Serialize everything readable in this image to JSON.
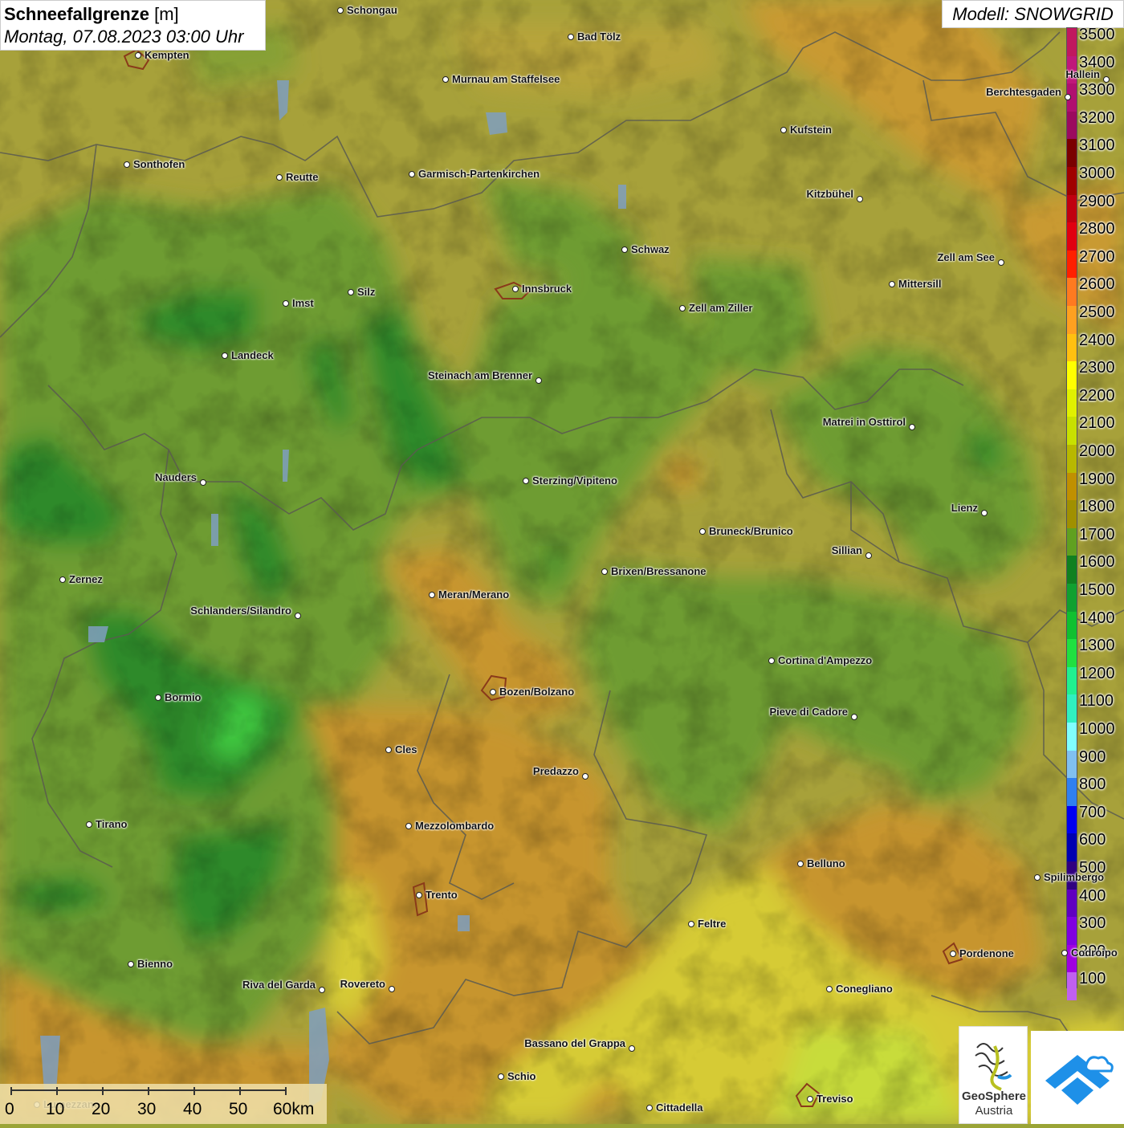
{
  "title": {
    "name": "Schneefallgrenze",
    "unit": "[m]",
    "datetime": "Montag, 07.08.2023 03:00 Uhr"
  },
  "model": "Modell: SNOWGRID",
  "legend": {
    "levels": [
      {
        "label": "3500",
        "color": "#c0185f"
      },
      {
        "label": "3400",
        "color": "#c0187a"
      },
      {
        "label": "3300",
        "color": "#b0106f"
      },
      {
        "label": "3200",
        "color": "#9b0a5f"
      },
      {
        "label": "3100",
        "color": "#7a0000"
      },
      {
        "label": "3000",
        "color": "#a00000"
      },
      {
        "label": "2900",
        "color": "#c00010"
      },
      {
        "label": "2800",
        "color": "#e00010"
      },
      {
        "label": "2700",
        "color": "#ff2000"
      },
      {
        "label": "2600",
        "color": "#ff7a20"
      },
      {
        "label": "2500",
        "color": "#ffa020"
      },
      {
        "label": "2400",
        "color": "#ffc010"
      },
      {
        "label": "2300",
        "color": "#ffff00"
      },
      {
        "label": "2200",
        "color": "#e0f000"
      },
      {
        "label": "2100",
        "color": "#c8e000"
      },
      {
        "label": "2000",
        "color": "#b8b800"
      },
      {
        "label": "1900",
        "color": "#c09000"
      },
      {
        "label": "1800",
        "color": "#a09000"
      },
      {
        "label": "1700",
        "color": "#60a020"
      },
      {
        "label": "1600",
        "color": "#108020"
      },
      {
        "label": "1500",
        "color": "#10a030"
      },
      {
        "label": "1400",
        "color": "#10c030"
      },
      {
        "label": "1300",
        "color": "#20e040"
      },
      {
        "label": "1200",
        "color": "#20f090"
      },
      {
        "label": "1100",
        "color": "#30f0c0"
      },
      {
        "label": "1000",
        "color": "#80ffff"
      },
      {
        "label": "900",
        "color": "#80c0f0"
      },
      {
        "label": "800",
        "color": "#3080f0"
      },
      {
        "label": "700",
        "color": "#0000f0"
      },
      {
        "label": "600",
        "color": "#0000b0"
      },
      {
        "label": "500",
        "color": "#300080"
      },
      {
        "label": "400",
        "color": "#6000c0"
      },
      {
        "label": "300",
        "color": "#8000e0"
      },
      {
        "label": "200",
        "color": "#a000e0"
      },
      {
        "label": "100",
        "color": "#c060f0"
      }
    ]
  },
  "cities": [
    {
      "name": "Schongau",
      "label_side": "right"
    },
    {
      "name": "Bad Tölz",
      "label_side": "right"
    },
    {
      "name": "Kempten",
      "label_side": "right"
    },
    {
      "name": "Murnau am Staffelsee",
      "label_side": "right"
    },
    {
      "name": "Hallein",
      "label_side": "left"
    },
    {
      "name": "Berchtesgaden",
      "label_side": "left"
    },
    {
      "name": "Kufstein",
      "label_side": "right"
    },
    {
      "name": "Sonthofen",
      "label_side": "right"
    },
    {
      "name": "Reutte",
      "label_side": "right"
    },
    {
      "name": "Garmisch-Partenkirchen",
      "label_side": "right"
    },
    {
      "name": "Kitzbühel",
      "label_side": "left"
    },
    {
      "name": "Schwaz",
      "label_side": "right"
    },
    {
      "name": "Zell am See",
      "label_side": "left"
    },
    {
      "name": "Innsbruck",
      "label_side": "right"
    },
    {
      "name": "Mittersill",
      "label_side": "right"
    },
    {
      "name": "Imst",
      "label_side": "right"
    },
    {
      "name": "Silz",
      "label_side": "right"
    },
    {
      "name": "Zell am Ziller",
      "label_side": "right"
    },
    {
      "name": "Landeck",
      "label_side": "right"
    },
    {
      "name": "Steinach am Brenner",
      "label_side": "left"
    },
    {
      "name": "Matrei in Osttirol",
      "label_side": "left"
    },
    {
      "name": "Nauders",
      "label_side": "left"
    },
    {
      "name": "Sterzing/Vipiteno",
      "label_side": "right"
    },
    {
      "name": "Lienz",
      "label_side": "left"
    },
    {
      "name": "Bruneck/Brunico",
      "label_side": "right"
    },
    {
      "name": "Sillian",
      "label_side": "left"
    },
    {
      "name": "Zernez",
      "label_side": "right"
    },
    {
      "name": "Brixen/Bressanone",
      "label_side": "right"
    },
    {
      "name": "Meran/Merano",
      "label_side": "right"
    },
    {
      "name": "Schlanders/Silandro",
      "label_side": "left"
    },
    {
      "name": "Cortina d'Ampezzo",
      "label_side": "right"
    },
    {
      "name": "Bozen/Bolzano",
      "label_side": "right"
    },
    {
      "name": "Bormio",
      "label_side": "right"
    },
    {
      "name": "Pieve di Cadore",
      "label_side": "left"
    },
    {
      "name": "Cles",
      "label_side": "right"
    },
    {
      "name": "Predazzo",
      "label_side": "left"
    },
    {
      "name": "Tirano",
      "label_side": "right"
    },
    {
      "name": "Mezzolombardo",
      "label_side": "right"
    },
    {
      "name": "Belluno",
      "label_side": "right"
    },
    {
      "name": "Spilimbergo",
      "label_side": "right"
    },
    {
      "name": "Trento",
      "label_side": "right"
    },
    {
      "name": "Feltre",
      "label_side": "right"
    },
    {
      "name": "Pordenone",
      "label_side": "right"
    },
    {
      "name": "Codroipo",
      "label_side": "right"
    },
    {
      "name": "Bienno",
      "label_side": "right"
    },
    {
      "name": "Riva del Garda",
      "label_side": "left"
    },
    {
      "name": "Rovereto",
      "label_side": "left"
    },
    {
      "name": "Conegliano",
      "label_side": "right"
    },
    {
      "name": "Bassano del Grappa",
      "label_side": "left"
    },
    {
      "name": "Schio",
      "label_side": "right"
    },
    {
      "name": "Treviso",
      "label_side": "right"
    },
    {
      "name": "Cittadella",
      "label_side": "right"
    },
    {
      "name": "Lumezzane",
      "label_side": "right"
    }
  ],
  "scale_bar": {
    "labels": [
      "0",
      "10",
      "20",
      "30",
      "40",
      "50",
      "60km"
    ]
  },
  "logos": {
    "geosphere_line1": "GeoSphere",
    "geosphere_line2": "Austria",
    "geosphere_icon": "geosphere-logo-icon",
    "app_icon": "mountain-cloud-icon"
  },
  "colors": {
    "background_ochre": "#a8a23a",
    "green_zone": "#6e9e30",
    "dark_green_zone": "#2f8a2a",
    "orange_zone": "#c9962e",
    "yellow_zone": "#d6d030",
    "accent_blue": "#1e90e8"
  }
}
